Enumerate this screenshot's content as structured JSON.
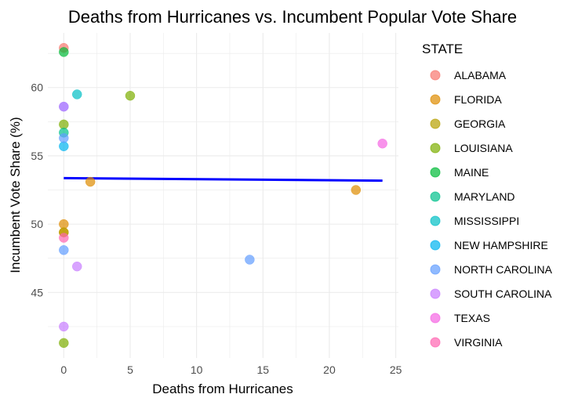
{
  "chart_data": {
    "type": "scatter",
    "title": "Deaths from Hurricanes vs. Incumbent Popular Vote Share",
    "xlabel": "Deaths from Hurricanes",
    "ylabel": "Incumbent Vote Share (%)",
    "xlim": [
      -1.2,
      25.2
    ],
    "ylim": [
      40.2,
      64.0
    ],
    "xticks": [
      0,
      5,
      10,
      15,
      20,
      25
    ],
    "yticks": [
      45,
      50,
      55,
      60
    ],
    "grid": true,
    "legend": {
      "title": "STATE",
      "position": "right",
      "entries": [
        {
          "name": "ALABAMA",
          "color": "#F8766D"
        },
        {
          "name": "FLORIDA",
          "color": "#DE8C00"
        },
        {
          "name": "GEORGIA",
          "color": "#B79F00"
        },
        {
          "name": "LOUISIANA",
          "color": "#7CAE00"
        },
        {
          "name": "MAINE",
          "color": "#00BA38"
        },
        {
          "name": "MARYLAND",
          "color": "#00C08B"
        },
        {
          "name": "MISSISSIPPI",
          "color": "#00BFC4"
        },
        {
          "name": "NEW HAMPSHIRE",
          "color": "#00B4F0"
        },
        {
          "name": "NORTH CAROLINA",
          "color": "#619CFF"
        },
        {
          "name": "SOUTH CAROLINA",
          "color": "#C77CFF"
        },
        {
          "name": "TEXAS",
          "color": "#F564E3"
        },
        {
          "name": "VIRGINIA",
          "color": "#FF64B0"
        }
      ]
    },
    "series": [
      {
        "name": "ALABAMA",
        "points": [
          [
            0,
            62.9
          ]
        ]
      },
      {
        "name": "FLORIDA",
        "points": [
          [
            0,
            50.0
          ],
          [
            0,
            49.4
          ],
          [
            2,
            53.1
          ],
          [
            22,
            52.5
          ]
        ]
      },
      {
        "name": "GEORGIA",
        "points": [
          [
            0,
            49.4
          ]
        ]
      },
      {
        "name": "LOUISIANA",
        "points": [
          [
            0,
            57.3
          ],
          [
            5,
            59.4
          ],
          [
            0,
            41.3
          ]
        ]
      },
      {
        "name": "MAINE",
        "points": [
          [
            0,
            62.6
          ]
        ]
      },
      {
        "name": "MARYLAND",
        "points": [
          [
            0,
            56.7
          ]
        ]
      },
      {
        "name": "MISSISSIPPI",
        "points": [
          [
            1,
            59.5
          ]
        ]
      },
      {
        "name": "NEW HAMPSHIRE",
        "points": [
          [
            0,
            55.7
          ]
        ]
      },
      {
        "name": "NORTH CAROLINA",
        "points": [
          [
            0,
            58.6
          ],
          [
            0,
            56.3
          ],
          [
            0,
            48.1
          ],
          [
            14,
            47.4
          ]
        ]
      },
      {
        "name": "SOUTH CAROLINA",
        "points": [
          [
            0,
            58.6
          ],
          [
            1,
            46.9
          ],
          [
            0,
            42.5
          ]
        ]
      },
      {
        "name": "TEXAS",
        "points": [
          [
            24,
            55.9
          ]
        ]
      },
      {
        "name": "VIRGINIA",
        "points": [
          [
            0,
            49.0
          ]
        ]
      }
    ],
    "trendline": {
      "type": "linear",
      "color": "#0000FF",
      "x": [
        0,
        24
      ],
      "y": [
        53.37,
        53.18
      ]
    }
  }
}
